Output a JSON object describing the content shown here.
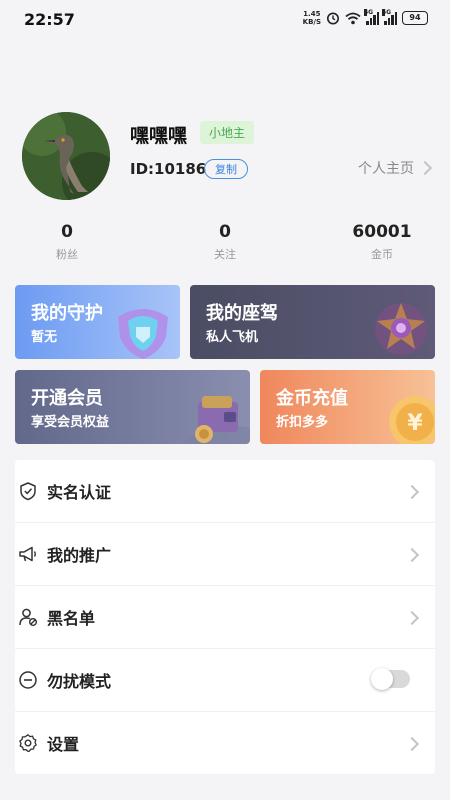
{
  "status_bar": {
    "time": "22:57",
    "net_speed_value": "1.45",
    "net_speed_unit": "KB/S",
    "sim1_tag": "4G",
    "sim2_tag": "5G",
    "battery": "94",
    "icons": [
      "alarm-icon",
      "wifi-icon",
      "signal-icon",
      "battery-icon"
    ]
  },
  "profile": {
    "nickname": "嘿嘿嘿",
    "level_badge": "小地主",
    "user_id": "ID:10186",
    "copy_label": "复制",
    "homepage_label": "个人主页"
  },
  "stats": [
    {
      "value": "0",
      "label": "粉丝"
    },
    {
      "value": "0",
      "label": "关注"
    },
    {
      "value": "60001",
      "label": "金币"
    }
  ],
  "cards": {
    "guard": {
      "title": "我的守护",
      "subtitle": "暂无"
    },
    "seat": {
      "title": "我的座驾",
      "subtitle": "私人飞机"
    },
    "vip": {
      "title": "开通会员",
      "subtitle": "享受会员权益"
    },
    "coin": {
      "title": "金币充值",
      "subtitle": "折扣多多"
    }
  },
  "menu": [
    {
      "label": "实名认证",
      "icon": "shield-check-icon"
    },
    {
      "label": "我的推广",
      "icon": "megaphone-icon"
    },
    {
      "label": "黑名单",
      "icon": "user-block-icon"
    },
    {
      "label": "勿扰模式",
      "icon": "do-not-disturb-icon",
      "toggle": false
    },
    {
      "label": "设置",
      "icon": "gear-icon"
    }
  ],
  "colors": {
    "accent_blue": "#3b82d9",
    "badge_green": "#4da651",
    "guard_card": "#6c9bf2",
    "seat_card": "#4a4d63",
    "vip_card": "#62688a",
    "coin_card": "#f0875c"
  }
}
